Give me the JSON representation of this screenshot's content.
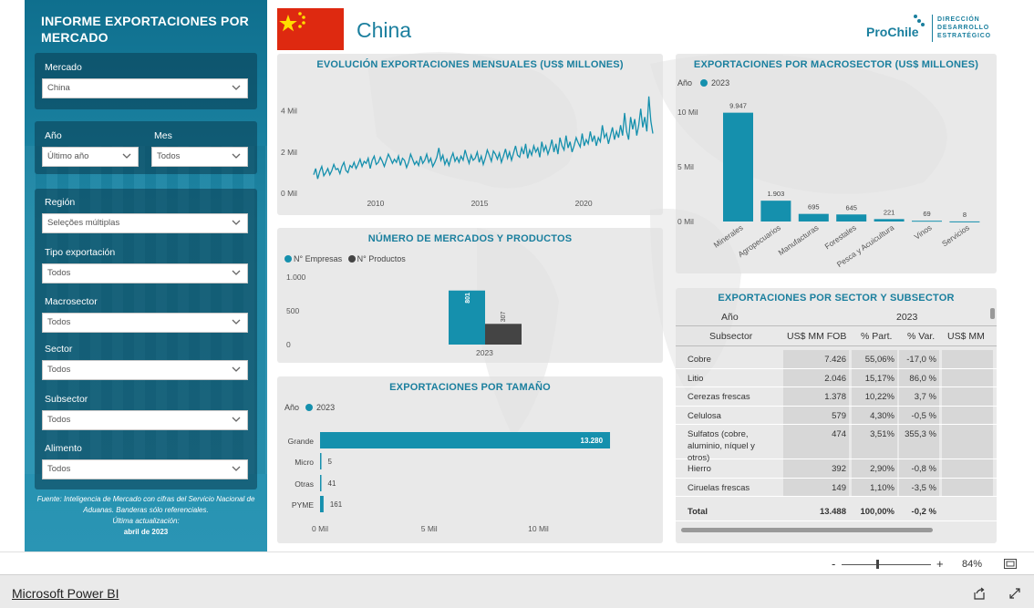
{
  "sidebar": {
    "title": "INFORME EXPORTACIONES POR MERCADO",
    "filters": [
      {
        "label": "Mercado",
        "value": "China"
      },
      {
        "label": "Año",
        "value": "Último año"
      },
      {
        "label": "Mes",
        "value": "Todos"
      },
      {
        "label": "Región",
        "value": "Seleções múltiplas"
      },
      {
        "label": "Tipo exportación",
        "value": "Todos"
      },
      {
        "label": "Macrosector",
        "value": "Todos"
      },
      {
        "label": "Sector",
        "value": "Todos"
      },
      {
        "label": "Subsector",
        "value": "Todos"
      },
      {
        "label": "Alimento",
        "value": "Todos"
      }
    ],
    "footnote": "Fuente: Inteligencia de Mercado con cifras del Servicio Nacional de Aduanas. Banderas sólo referenciales.",
    "updated_label": "Última actualización:",
    "updated_value": "abril de 2023"
  },
  "header": {
    "country": "China",
    "logo_brand": "ProChile",
    "logo_text": [
      "DIRECCIÓN",
      "DESARROLLO",
      "ESTRATÉGICO"
    ]
  },
  "colors": {
    "accent": "#1590ad",
    "dark": "#444444",
    "flag_red": "#de2910",
    "flag_yellow": "#ffde00"
  },
  "monthly": {
    "title": "EVOLUCIÓN EXPORTACIONES MENSUALES (US$ MILLONES)",
    "chart_data": {
      "type": "line",
      "ylim": [
        0,
        5000
      ],
      "yticks": [
        "0 Mil",
        "2 Mil",
        "4 Mil"
      ],
      "xticks": [
        "2010",
        "2015",
        "2020"
      ],
      "x_range": [
        2007.0,
        2023.3
      ],
      "y": [
        900,
        1200,
        700,
        1050,
        1300,
        850,
        1000,
        1200,
        900,
        1100,
        1400,
        1150,
        1200,
        950,
        1300,
        1500,
        1100,
        1000,
        1350,
        1250,
        1500,
        1200,
        1400,
        1650,
        1300,
        1550,
        1450,
        1700,
        1200,
        1600,
        1800,
        1400,
        1500,
        1750,
        1550,
        1300,
        1600,
        1900,
        1700,
        1450,
        1650,
        1500,
        1800,
        1350,
        1700,
        1600,
        1250,
        1500,
        1900,
        1650,
        1400,
        1550,
        1350,
        1800,
        1450,
        1600,
        1900,
        1500,
        1700,
        1300,
        1500,
        1750,
        2200,
        1600,
        1850,
        1400,
        1650,
        1350,
        1700,
        1950,
        1550,
        1750,
        1500,
        1800,
        1600,
        2100,
        1750,
        1450,
        1850,
        1600,
        1700,
        2000,
        1500,
        1800,
        1400,
        1700,
        2100,
        1850,
        1550,
        2050,
        1900,
        1650,
        1950,
        1500,
        1800,
        2150,
        1700,
        2000,
        1600,
        1950,
        2300,
        1850,
        1750,
        2200,
        1900,
        2400,
        1700,
        2100,
        1850,
        2300,
        2000,
        2200,
        1750,
        2500,
        2050,
        2300,
        1900,
        2200,
        2600,
        2000,
        2400,
        1900,
        2700,
        2300,
        2100,
        2800,
        2200,
        2500,
        2000,
        2300,
        2700,
        2450,
        2250,
        2900,
        2300,
        2600,
        2400,
        3000,
        2500,
        2800,
        2300,
        2700,
        2500,
        3300,
        2700,
        2900,
        2400,
        2800,
        3200,
        2600,
        3000,
        2700,
        3300,
        2800,
        3900,
        3000,
        2600,
        3700,
        3100,
        3600,
        2800,
        3300,
        4100,
        3200,
        3700,
        3000,
        4700,
        3500,
        2900
      ]
    }
  },
  "macro": {
    "title": "EXPORTACIONES POR MACROSECTOR (US$ MILLONES)",
    "legend_prefix": "Año",
    "legend_item": "2023",
    "chart_data": {
      "type": "bar",
      "categories": [
        "Minerales",
        "Agropecuarios",
        "Manufacturas",
        "Forestales",
        "Pesca y Acuicultura",
        "Vinos",
        "Servicios"
      ],
      "values": [
        9947,
        1903,
        695,
        645,
        221,
        69,
        8
      ],
      "value_labels": [
        "9.947",
        "1.903",
        "695",
        "645",
        "221",
        "69",
        "8"
      ],
      "ylim": [
        0,
        11500
      ],
      "yticks": [
        "0 Mil",
        "5 Mil",
        "10 Mil"
      ],
      "series": [
        {
          "name": "2023"
        }
      ]
    }
  },
  "markets": {
    "title": "NÚMERO DE MERCADOS Y PRODUCTOS",
    "chart_data": {
      "type": "bar",
      "categories": [
        "2023"
      ],
      "series": [
        {
          "name": "N° Empresas",
          "values": [
            801
          ]
        },
        {
          "name": "N° Productos",
          "values": [
            307
          ]
        }
      ],
      "ylim": [
        0,
        1000
      ],
      "yticks": [
        "0",
        "500",
        "1.000"
      ]
    }
  },
  "size": {
    "title": "EXPORTACIONES POR TAMAÑO",
    "legend_prefix": "Año",
    "legend_item": "2023",
    "chart_data": {
      "type": "bar",
      "categories": [
        "Grande",
        "Micro",
        "Otras",
        "PYME"
      ],
      "values": [
        13280,
        5,
        41,
        161
      ],
      "value_labels": [
        "13.280",
        "5",
        "41",
        "161"
      ],
      "xlim": [
        0,
        15200
      ],
      "xticks": [
        "0 Mil",
        "5 Mil",
        "10 Mil"
      ],
      "series": [
        {
          "name": "2023"
        }
      ]
    }
  },
  "subsector": {
    "title": "EXPORTACIONES POR SECTOR Y SUBSECTOR",
    "year_label": "Año",
    "year_value": "2023",
    "columns": [
      "Subsector",
      "US$ MM FOB",
      "% Part.",
      "% Var.",
      "US$ MM"
    ],
    "rows": [
      [
        "Cobre",
        "7.426",
        "55,06%",
        "-17,0 %"
      ],
      [
        "Litio",
        "2.046",
        "15,17%",
        "86,0 %"
      ],
      [
        "Cerezas frescas",
        "1.378",
        "10,22%",
        "3,7 %"
      ],
      [
        "Celulosa",
        "579",
        "4,30%",
        "-0,5 %"
      ],
      [
        "Sulfatos (cobre, aluminio, níquel y otros)",
        "474",
        "3,51%",
        "355,3 %"
      ],
      [
        "Hierro",
        "392",
        "2,90%",
        "-0,8 %"
      ],
      [
        "Ciruelas frescas",
        "149",
        "1,10%",
        "-3,5 %"
      ]
    ],
    "total": [
      "Total",
      "13.488",
      "100,00%",
      "-0,2 %"
    ]
  },
  "statusbar": {
    "zoom": "84%",
    "minus": "-",
    "plus": "+"
  },
  "footer": {
    "brand": "Microsoft Power BI"
  }
}
